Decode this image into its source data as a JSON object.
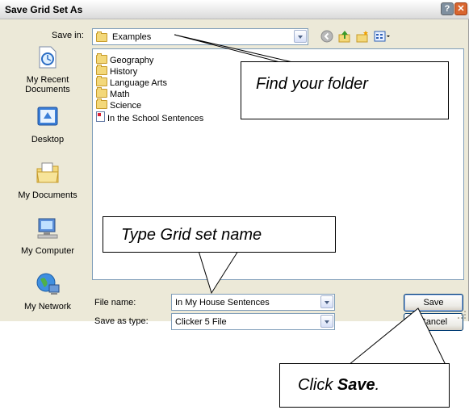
{
  "window": {
    "title": "Save Grid Set As",
    "help_glyph": "?",
    "close_glyph": "✕"
  },
  "toolbar": {
    "save_in_label": "Save in:",
    "save_in_value": "Examples",
    "icons": [
      "back-icon",
      "up-folder-icon",
      "new-folder-icon",
      "views-menu-icon"
    ]
  },
  "places": [
    {
      "name": "my-recent-documents",
      "label_lines": [
        "My Recent",
        "Documents"
      ]
    },
    {
      "name": "desktop",
      "label_lines": [
        "Desktop",
        ""
      ]
    },
    {
      "name": "my-documents",
      "label_lines": [
        "My Documents",
        ""
      ]
    },
    {
      "name": "my-computer",
      "label_lines": [
        "My Computer",
        ""
      ]
    },
    {
      "name": "my-network",
      "label_lines": [
        "My Network",
        ""
      ]
    }
  ],
  "files": [
    {
      "type": "folder",
      "label": "Geography"
    },
    {
      "type": "folder",
      "label": "History"
    },
    {
      "type": "folder",
      "label": "Language Arts"
    },
    {
      "type": "folder",
      "label": "Math"
    },
    {
      "type": "folder",
      "label": "Science"
    },
    {
      "type": "document",
      "label": "In the School Sentences"
    }
  ],
  "fields": {
    "file_name_label": "File name:",
    "file_name_value": "In My House Sentences",
    "save_as_type_label": "Save as type:",
    "save_as_type_value": "Clicker 5 File"
  },
  "buttons": {
    "save": "Save",
    "cancel": "Cancel"
  },
  "callouts": {
    "find_folder": "Find your folder",
    "type_name": "Type Grid set name",
    "click_save_prefix": "Click ",
    "click_save_bold": "Save",
    "click_save_suffix": "."
  }
}
